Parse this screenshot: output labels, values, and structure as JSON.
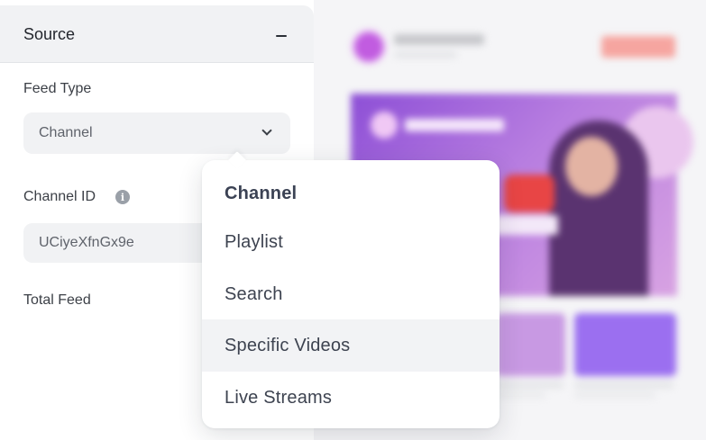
{
  "source_panel": {
    "title": "Source",
    "collapse_icon": "minus-icon",
    "feed_type": {
      "label": "Feed Type",
      "selected": "Channel",
      "dropdown_icon": "chevron-down-icon"
    },
    "channel_id": {
      "label": "Channel ID",
      "info_icon": "info-icon",
      "info_glyph": "i",
      "value": "UCiyeXfnGx9e"
    },
    "total_feed": {
      "label": "Total Feed"
    }
  },
  "feed_type_menu": {
    "options": [
      {
        "label": "Channel",
        "state": "selected"
      },
      {
        "label": "Playlist",
        "state": "default"
      },
      {
        "label": "Search",
        "state": "default"
      },
      {
        "label": "Specific Videos",
        "state": "hover"
      },
      {
        "label": "Live Streams",
        "state": "default"
      }
    ]
  },
  "colors": {
    "panel_header_bg": "#f1f2f4",
    "input_bg": "#f1f2f4",
    "hover_bg": "#f2f3f5",
    "text": "#3d4350"
  }
}
